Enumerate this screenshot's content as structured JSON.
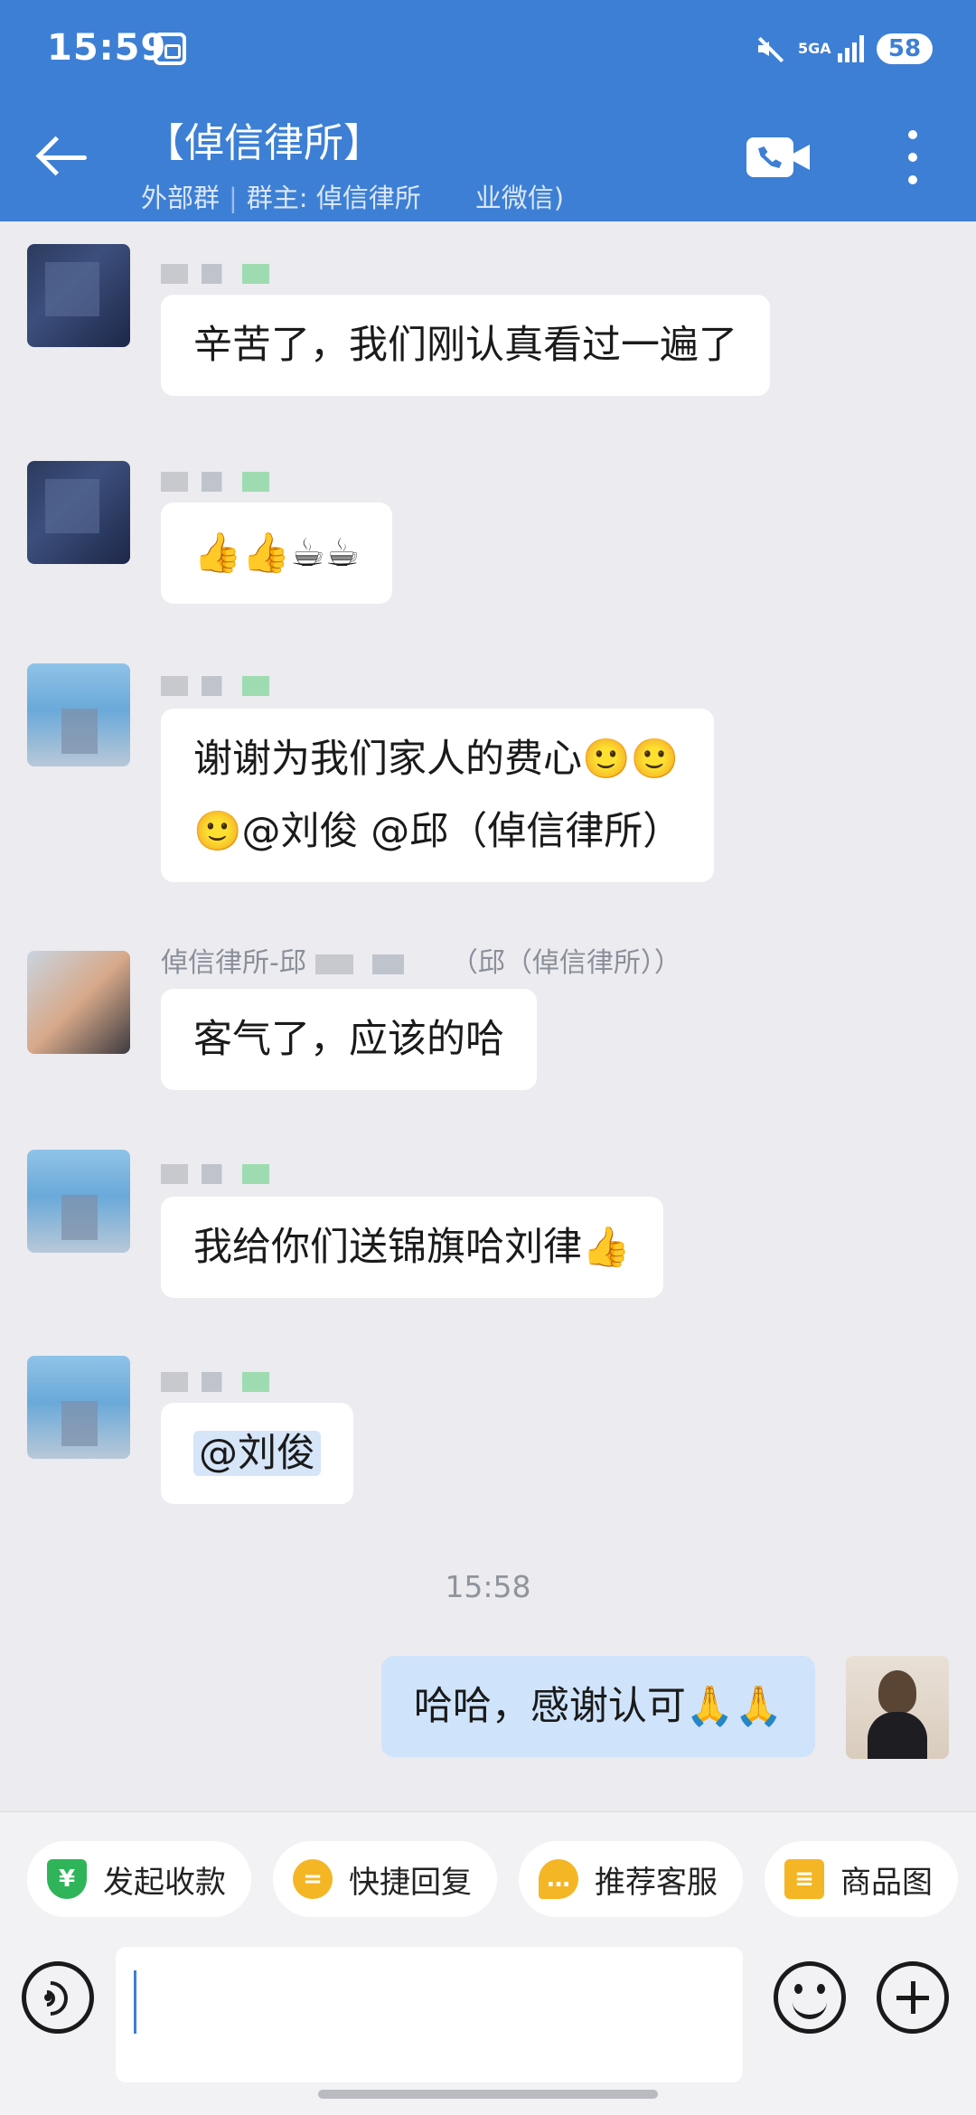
{
  "status_bar": {
    "time": "15:59",
    "network": "5GA",
    "battery": "58"
  },
  "header": {
    "title": "【倬信律所】",
    "subtitle_group_type": "外部群",
    "subtitle_owner": "群主: 倬信律所",
    "subtitle_suffix": "业微信)"
  },
  "messages": [
    {
      "text": "辛苦了，我们刚认真看过一遍了"
    },
    {
      "text": "👍👍☕☕"
    },
    {
      "line1": "谢谢为我们家人的费心🙂🙂",
      "line2": "🙂@刘俊 @邱（倬信律所）"
    },
    {
      "sender_prefix": "倬信律所-邱",
      "sender_suffix": "（邱（倬信律所））",
      "text": "客气了，应该的哈"
    },
    {
      "text": "我给你们送锦旗哈刘律👍"
    },
    {
      "text": "@刘俊"
    }
  ],
  "time_separator": "15:58",
  "my_message": {
    "text": "哈哈，感谢认可🙏🙏"
  },
  "quick_actions": [
    {
      "label": "发起收款",
      "icon": "yen-icon"
    },
    {
      "label": "快捷回复",
      "icon": "quick-reply-icon"
    },
    {
      "label": "推荐客服",
      "icon": "service-icon"
    },
    {
      "label": "商品图",
      "icon": "goods-icon"
    }
  ],
  "input": {
    "placeholder": ""
  }
}
